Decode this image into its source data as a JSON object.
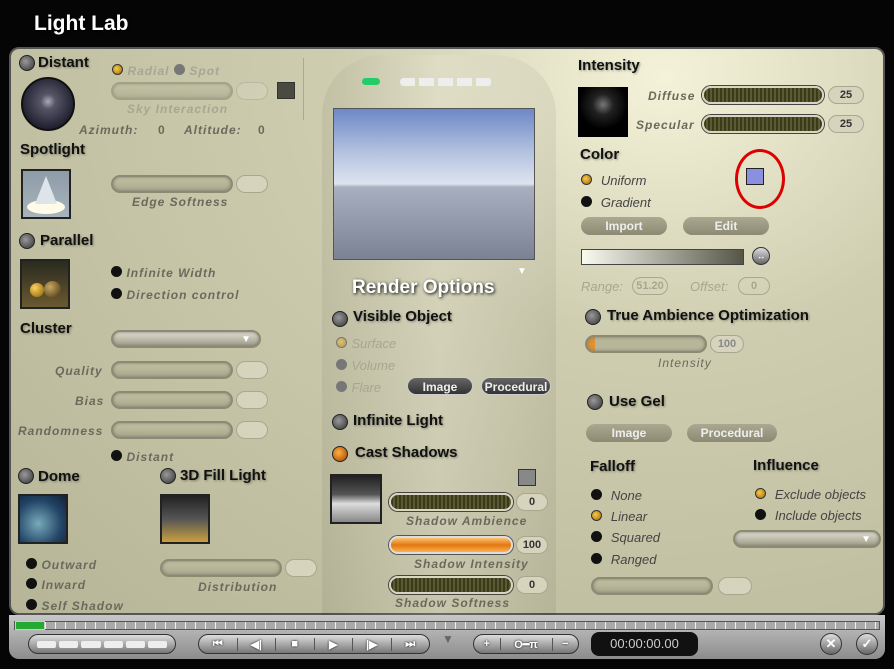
{
  "window": {
    "title": "Light Lab"
  },
  "left": {
    "distant": "Distant",
    "radial": "Radial",
    "spot": "Spot",
    "sky_interaction": "Sky Interaction",
    "azimuth_label": "Azimuth:",
    "azimuth": "0",
    "altitude_label": "Altitude:",
    "altitude": "0",
    "spotlight": "Spotlight",
    "edge_softness": "Edge Softness",
    "parallel": "Parallel",
    "infinite_width": "Infinite Width",
    "direction_control": "Direction control",
    "cluster": "Cluster",
    "quality": "Quality",
    "bias": "Bias",
    "randomness": "Randomness",
    "distant_opt": "Distant",
    "dome": "Dome",
    "fill_light": "3D Fill Light",
    "outward": "Outward",
    "inward": "Inward",
    "self_shadow": "Self Shadow",
    "distribution": "Distribution"
  },
  "center": {
    "render_options": "Render Options",
    "visible_object": "Visible Object",
    "surface": "Surface",
    "volume": "Volume",
    "flare": "Flare",
    "image_btn": "Image",
    "procedural_btn": "Procedural",
    "infinite_light": "Infinite Light",
    "cast_shadows": "Cast Shadows",
    "shadow_ambience": "Shadow Ambience",
    "shadow_ambience_value": "0",
    "shadow_intensity": "Shadow Intensity",
    "shadow_intensity_value": "100",
    "shadow_softness": "Shadow Softness",
    "shadow_softness_value": "0"
  },
  "right": {
    "intensity": "Intensity",
    "diffuse": "Diffuse",
    "diffuse_value": "25",
    "specular": "Specular",
    "specular_value": "25",
    "color": "Color",
    "uniform": "Uniform",
    "gradient": "Gradient",
    "color_swatch": "#8a8fe0",
    "import": "Import",
    "edit": "Edit",
    "range_label": "Range:",
    "range": "51.20",
    "offset_label": "Offset:",
    "offset": "0",
    "true_ambience": "True Ambience Optimization",
    "ambience_intensity": "Intensity",
    "ambience_value": "100",
    "use_gel": "Use Gel",
    "gel_image": "Image",
    "gel_procedural": "Procedural",
    "falloff": "Falloff",
    "none": "None",
    "linear": "Linear",
    "squared": "Squared",
    "ranged": "Ranged",
    "influence": "Influence",
    "exclude": "Exclude objects",
    "include": "Include objects"
  },
  "bottom": {
    "timecode": "00:00:00.00",
    "transport": [
      "⏮",
      "◀|",
      "■",
      "▶",
      "|▶",
      "⏭"
    ],
    "key_controls": [
      "+",
      "O━π",
      "−"
    ],
    "cancel": "✕",
    "ok": "✓"
  }
}
